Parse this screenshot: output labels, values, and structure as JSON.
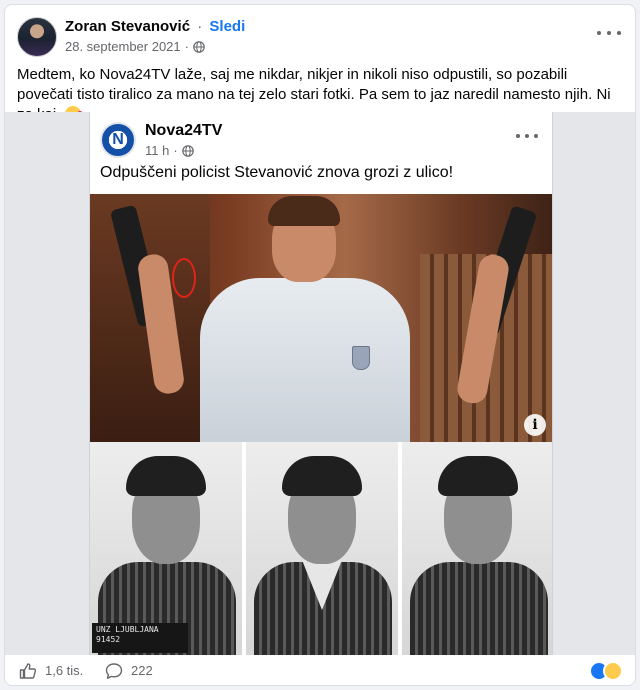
{
  "post": {
    "author": "Zoran Stevanović",
    "separator": "·",
    "follow_label": "Sledi",
    "date": "28. september 2021",
    "meta_separator": "·",
    "text": "Medtem, ko Nova24TV laže, saj me nikdar, nikjer in nikoli niso odpustili, so pozabili povečati tisto tiralico za mano na tej zelo stari fotki. Pa sem to jaz naredil namesto njih. Ni za kaj.",
    "emoji_icon": "wink-kiss-emoji-icon",
    "privacy_icon": "globe-icon"
  },
  "shared": {
    "page_name": "Nova24TV",
    "logo_text": "N",
    "time": "11 h",
    "meta_separator": "·",
    "headline": "Odpuščeni policist Stevanović znova grozi z ulico!",
    "info_label": "i",
    "plate_line_1": "UNZ LJUBLJANA",
    "plate_line_2": "91452"
  },
  "footer": {
    "likes": "1,6 tis.",
    "comments": "222",
    "like_icon": "thumbs-up-icon",
    "comment_icon": "comment-bubble-icon"
  },
  "colors": {
    "accent": "#1877f2",
    "secondary_text": "#65676b",
    "circle_highlight": "#e0241b"
  }
}
